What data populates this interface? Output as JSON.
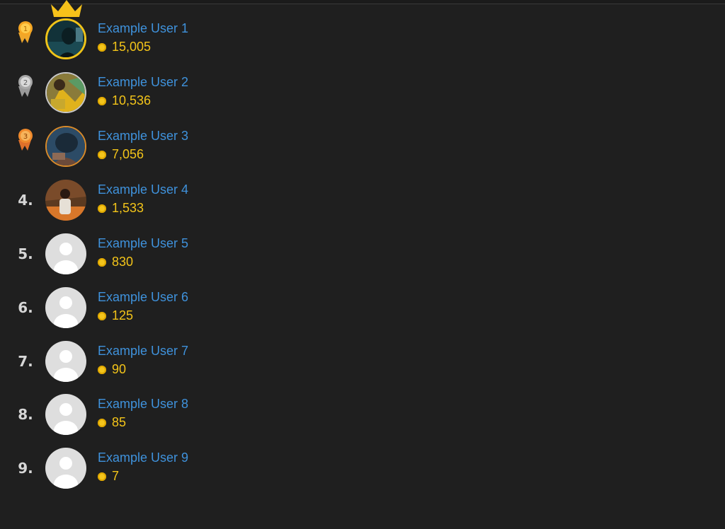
{
  "colors": {
    "background": "#1f1f1f",
    "username": "#3f92dc",
    "coin": "#f4c51c",
    "rank_text": "#d6d6d6",
    "gold": "#f0c419",
    "silver": "#c9c9c9",
    "bronze": "#d88a2a"
  },
  "leaderboard": [
    {
      "rank": "1",
      "medal": "gold-medal-icon",
      "name": "Example User 1",
      "coins": "15,005",
      "avatar": "photo",
      "crown": "crown-icon"
    },
    {
      "rank": "2",
      "medal": "silver-medal-icon",
      "name": "Example User 2",
      "coins": "10,536",
      "avatar": "photo"
    },
    {
      "rank": "3",
      "medal": "bronze-medal-icon",
      "name": "Example User 3",
      "coins": "7,056",
      "avatar": "photo"
    },
    {
      "rank": "4.",
      "name": "Example User 4",
      "coins": "1,533",
      "avatar": "photo"
    },
    {
      "rank": "5.",
      "name": "Example User 5",
      "coins": "830",
      "avatar": "default-avatar-icon"
    },
    {
      "rank": "6.",
      "name": "Example User 6",
      "coins": "125",
      "avatar": "default-avatar-icon"
    },
    {
      "rank": "7.",
      "name": "Example User 7",
      "coins": "90",
      "avatar": "default-avatar-icon"
    },
    {
      "rank": "8.",
      "name": "Example User 8",
      "coins": "85",
      "avatar": "default-avatar-icon"
    },
    {
      "rank": "9.",
      "name": "Example User 9",
      "coins": "7",
      "avatar": "default-avatar-icon"
    }
  ]
}
